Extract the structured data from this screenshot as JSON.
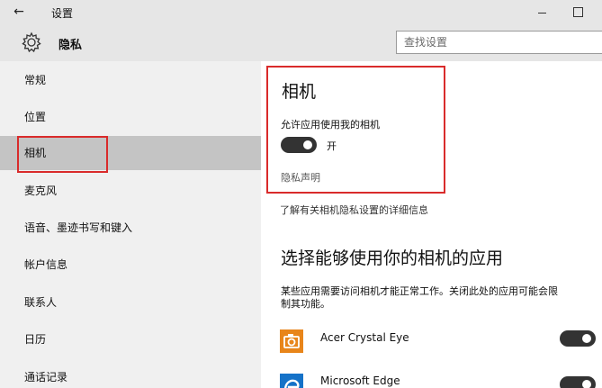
{
  "window": {
    "title": "设置",
    "back_icon": "←"
  },
  "header": {
    "section_title": "隐私",
    "search_placeholder": "查找设置",
    "gear_icon": "gear-icon"
  },
  "sidebar": {
    "items": [
      {
        "label": "常规"
      },
      {
        "label": "位置"
      },
      {
        "label": "相机"
      },
      {
        "label": "麦克风"
      },
      {
        "label": "语音、墨迹书写和键入"
      },
      {
        "label": "帐户信息"
      },
      {
        "label": "联系人"
      },
      {
        "label": "日历"
      },
      {
        "label": "通话记录"
      }
    ],
    "selected": "相机"
  },
  "main": {
    "title": "相机",
    "allow_label": "允许应用使用我的相机",
    "toggle_state": "开",
    "privacy_link": "隐私声明",
    "learn_more": "了解有关相机隐私设置的详细信息",
    "section_title": "选择能够使用你的相机的应用",
    "description_line1": "某些应用需要访问相机才能正常工作。关闭此处的应用可能会限",
    "description_line2": "制其功能。",
    "apps": [
      {
        "name": "Acer Crystal Eye",
        "icon": "camera-app-icon",
        "enabled": true
      },
      {
        "name": "Microsoft Edge",
        "icon": "edge-icon",
        "enabled": true
      }
    ]
  },
  "colors": {
    "highlight": "#d92b2b",
    "toggle_on": "#333333",
    "sidebar_bg": "#f0f0f0",
    "selected_bg": "#c4c4c4"
  }
}
